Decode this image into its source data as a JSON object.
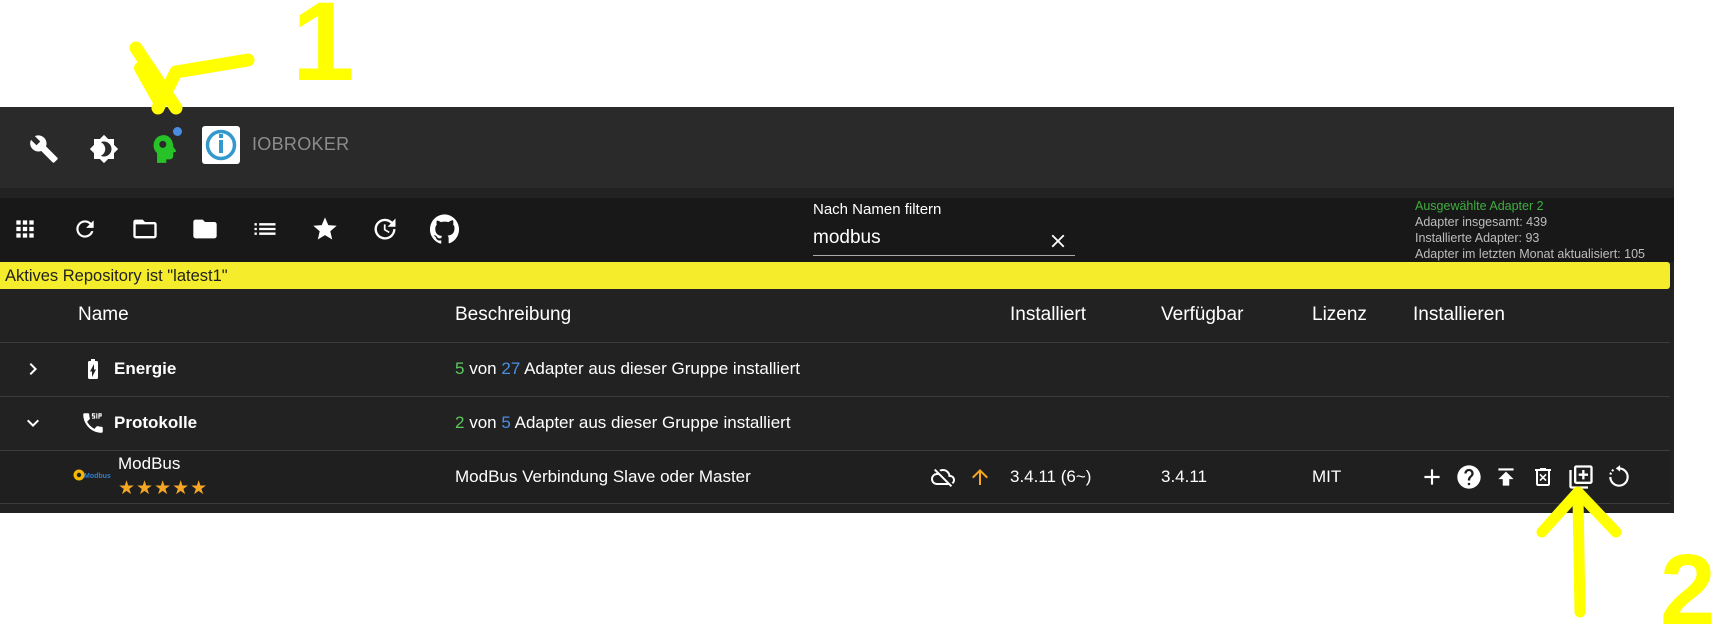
{
  "topbar": {
    "brand": "IOBROKER",
    "icons": [
      "wrench-icon",
      "brightness-icon",
      "expert-mode-icon",
      "iobroker-logo"
    ]
  },
  "toolbar": {
    "icons": [
      "grid-view-icon",
      "refresh-icon",
      "folder-outline-icon",
      "folder-icon",
      "list-icon",
      "star-icon",
      "update-icon",
      "github-icon"
    ],
    "filter": {
      "label": "Nach Namen filtern",
      "value": "modbus"
    },
    "stats": {
      "selected": "Ausgewählte Adapter 2",
      "total": "Adapter insgesamt: 439",
      "installed": "Installierte Adapter: 93",
      "updated": "Adapter im letzten Monat aktualisiert: 105"
    }
  },
  "repo_banner": "Aktives Repository ist \"latest1\"",
  "table": {
    "headers": {
      "name": "Name",
      "description": "Beschreibung",
      "installed": "Installiert",
      "available": "Verfügbar",
      "license": "Lizenz",
      "install": "Installieren"
    },
    "groups": [
      {
        "name": "Energie",
        "installed_count": "5",
        "of": "von",
        "total_count": "27",
        "suffix": "Adapter aus dieser Gruppe installiert",
        "expanded": false
      },
      {
        "name": "Protokolle",
        "installed_count": "2",
        "of": "von",
        "total_count": "5",
        "suffix": "Adapter aus dieser Gruppe installiert",
        "expanded": true
      }
    ],
    "adapter": {
      "name": "ModBus",
      "logo_text": "Modbus",
      "stars": "★★★★★",
      "rating": 5,
      "description": "ModBus Verbindung Slave oder Master",
      "installed": "3.4.11 (6~)",
      "available": "3.4.11",
      "license": "MIT"
    }
  },
  "annotations": {
    "label_1": "1",
    "label_2": "2",
    "color": "#ffff00"
  },
  "colors": {
    "accent_green": "#3fae3f",
    "accent_blue": "#4a90e2",
    "star": "#f5a623",
    "banner": "#f5ec2b"
  }
}
